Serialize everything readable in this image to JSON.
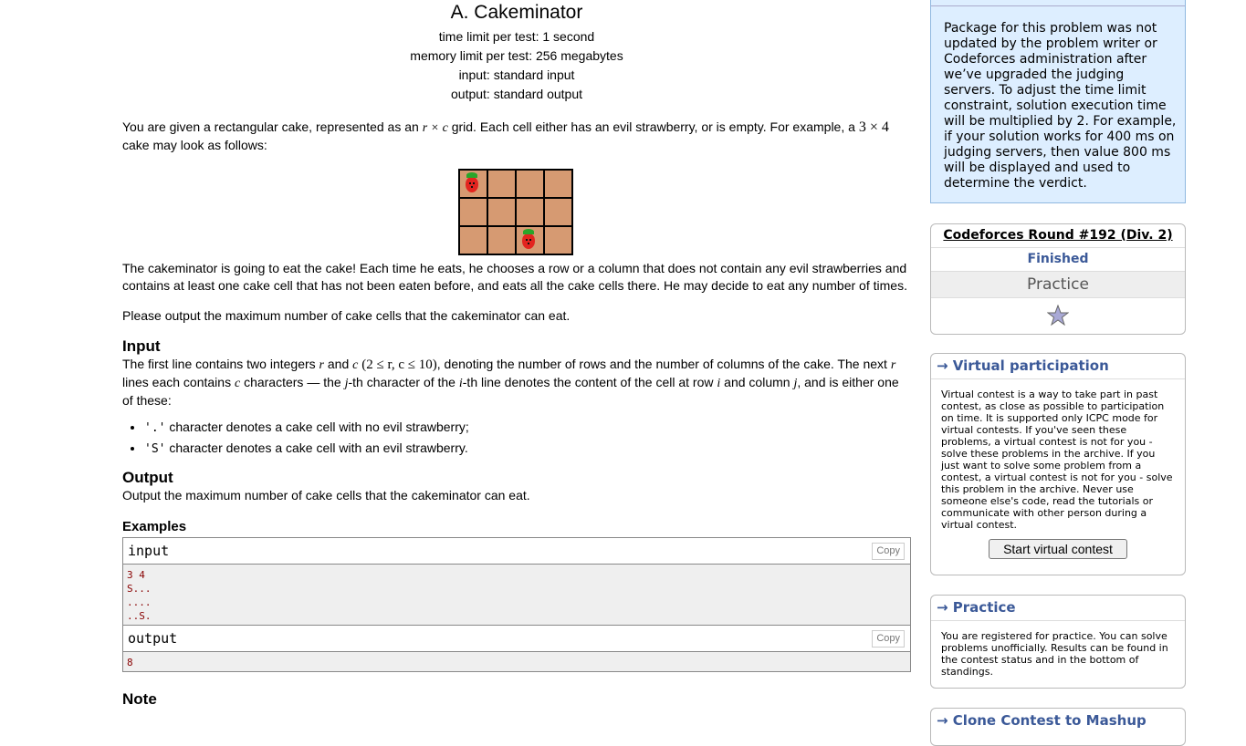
{
  "problem": {
    "title": "A. Cakeminator",
    "time_limit": "time limit per test: 1 second",
    "memory_limit": "memory limit per test: 256 megabytes",
    "input_file": "input: standard input",
    "output_file": "output: standard output",
    "intro_a": "You are given a rectangular cake, represented as an ",
    "intro_rxc": "r × c",
    "intro_b": " grid. Each cell either has an evil strawberry, or is empty. For example, a ",
    "intro_3x4": "3 × 4",
    "intro_c": " cake may look as follows:",
    "eat_text": "The cakeminator is going to eat the cake! Each time he eats, he chooses a row or a column that does not contain any evil strawberries and contains at least one cake cell that has not been eaten before, and eats all the cake cells there. He may decide to eat any number of times.",
    "output_request": "Please output the maximum number of cake cells that the cakeminator can eat.",
    "input_title": "Input",
    "input_a": "The first line contains two integers ",
    "input_r": "r",
    "input_and": " and ",
    "input_c": "c",
    "input_constraint": "(2 ≤ r, c ≤ 10)",
    "input_b": ", denoting the number of rows and the number of columns of the cake. The next ",
    "input_r2": "r",
    "input_c2_pre": " lines each contains ",
    "input_c2": "c",
    "input_c2_post": " characters — the ",
    "input_j": "j",
    "input_jpost": "-th character of the ",
    "input_i": "i",
    "input_ipost": "-th line denotes the content of the cell at row ",
    "input_i2": "i",
    "input_col": " and column ",
    "input_j2": "j",
    "input_end": ", and is either one of these:",
    "bullet1_code": "'.'",
    "bullet1_text": " character denotes a cake cell with no evil strawberry;",
    "bullet2_code": "'S'",
    "bullet2_text": " character denotes a cake cell with an evil strawberry.",
    "output_title": "Output",
    "output_text": "Output the maximum number of cake cells that the cakeminator can eat.",
    "examples_title": "Examples",
    "sample_input_label": "input",
    "sample_output_label": "output",
    "copy_label": "Copy",
    "sample_input_lines": [
      "3 4",
      "S...",
      "....",
      "..S."
    ],
    "sample_output": "8",
    "note_title": "Note",
    "cake_strawberries": [
      "S...",
      "....",
      "..S."
    ]
  },
  "sidebar": {
    "notice": "Package for this problem was not updated by the problem writer or Codeforces administration after we’ve upgraded the judging servers. To adjust the time limit constraint, solution execution time will be multiplied by 2. For example, if your solution works for 400 ms on judging servers, then value 800 ms will be displayed and used to determine the verdict.",
    "round_name": "Codeforces Round #192 (Div. 2)",
    "round_status": "Finished",
    "round_mode": "Practice",
    "virtual_title": "→ Virtual participation",
    "virtual_text": "Virtual contest is a way to take part in past contest, as close as possible to participation on time. It is supported only ICPC mode for virtual contests. If you've seen these problems, a virtual contest is not for you - solve these problems in the archive. If you just want to solve some problem from a contest, a virtual contest is not for you - solve this problem in the archive. Never use someone else's code, read the tutorials or communicate with other person during a virtual contest.",
    "virtual_button": "Start virtual contest",
    "practice_title": "→ Practice",
    "practice_text": "You are registered for practice. You can solve problems unofficially. Results can be found in the contest status and in the bottom of standings.",
    "clone_title": "→ Clone Contest to Mashup"
  }
}
